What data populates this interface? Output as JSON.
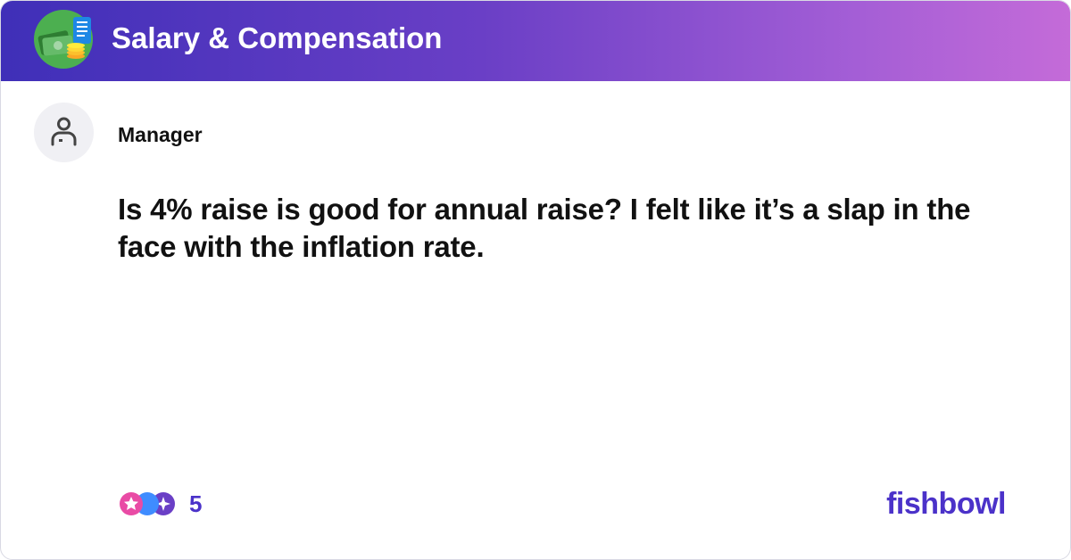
{
  "header": {
    "bowl_icon": "salary-compensation-money-icon",
    "title": "Salary & Compensation",
    "gradient_colors": [
      "#3f2fb8",
      "#c46bd8"
    ]
  },
  "post": {
    "avatar_icon": "user-icon",
    "author": "Manager",
    "body": "Is 4% raise is good for annual raise? I felt like it’s a slap in the face with the inflation rate."
  },
  "footer": {
    "reaction_icons": [
      "star-reaction-icon",
      "moon-reaction-icon",
      "sparkle-reaction-icon"
    ],
    "reaction_count": "5",
    "brand": "fishbowl",
    "brand_color": "#4b32c9"
  }
}
